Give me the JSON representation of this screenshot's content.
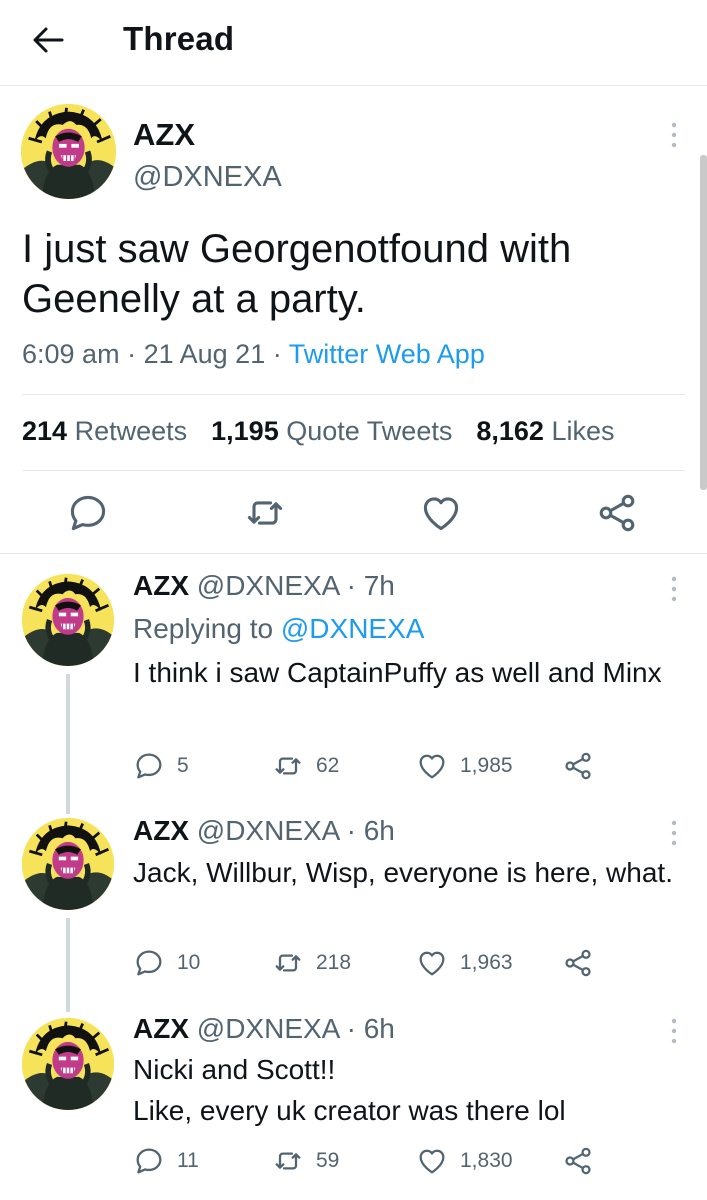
{
  "header": {
    "title": "Thread"
  },
  "main_tweet": {
    "name": "AZX",
    "handle": "@DXNEXA",
    "text": "I just saw Georgenotfound with Geenelly at a party.",
    "time": "6:09 am",
    "date": "21 Aug 21",
    "separator": "·",
    "source": "Twitter Web App",
    "retweets": "214",
    "retweets_label": "Retweets",
    "quotes": "1,195",
    "quotes_label": "Quote Tweets",
    "likes": "8,162",
    "likes_label": "Likes"
  },
  "replies": [
    {
      "name": "AZX",
      "handle": "@DXNEXA",
      "time": "· 7h",
      "replying_label": "Replying to",
      "replying_to": "@DXNEXA",
      "text": "I think i saw CaptainPuffy as well and Minx",
      "replies": "5",
      "retweets": "62",
      "likes": "1,985"
    },
    {
      "name": "AZX",
      "handle": "@DXNEXA",
      "time": "· 6h",
      "text": "Jack, Willbur, Wisp, everyone is here, what.",
      "replies": "10",
      "retweets": "218",
      "likes": "1,963"
    },
    {
      "name": "AZX",
      "handle": "@DXNEXA",
      "time": "· 6h",
      "text_line1": "Nicki and Scott!!",
      "text_line2": "Like, every uk creator was there lol",
      "replies": "11",
      "retweets": "59",
      "likes": "1,830"
    }
  ],
  "colors": {
    "link": "#1d9bf0",
    "muted": "#536471",
    "avatar_bg": "#f7e35a"
  },
  "icons": [
    "back-arrow-icon",
    "more-icon",
    "reply-icon",
    "retweet-icon",
    "like-icon",
    "share-icon"
  ]
}
